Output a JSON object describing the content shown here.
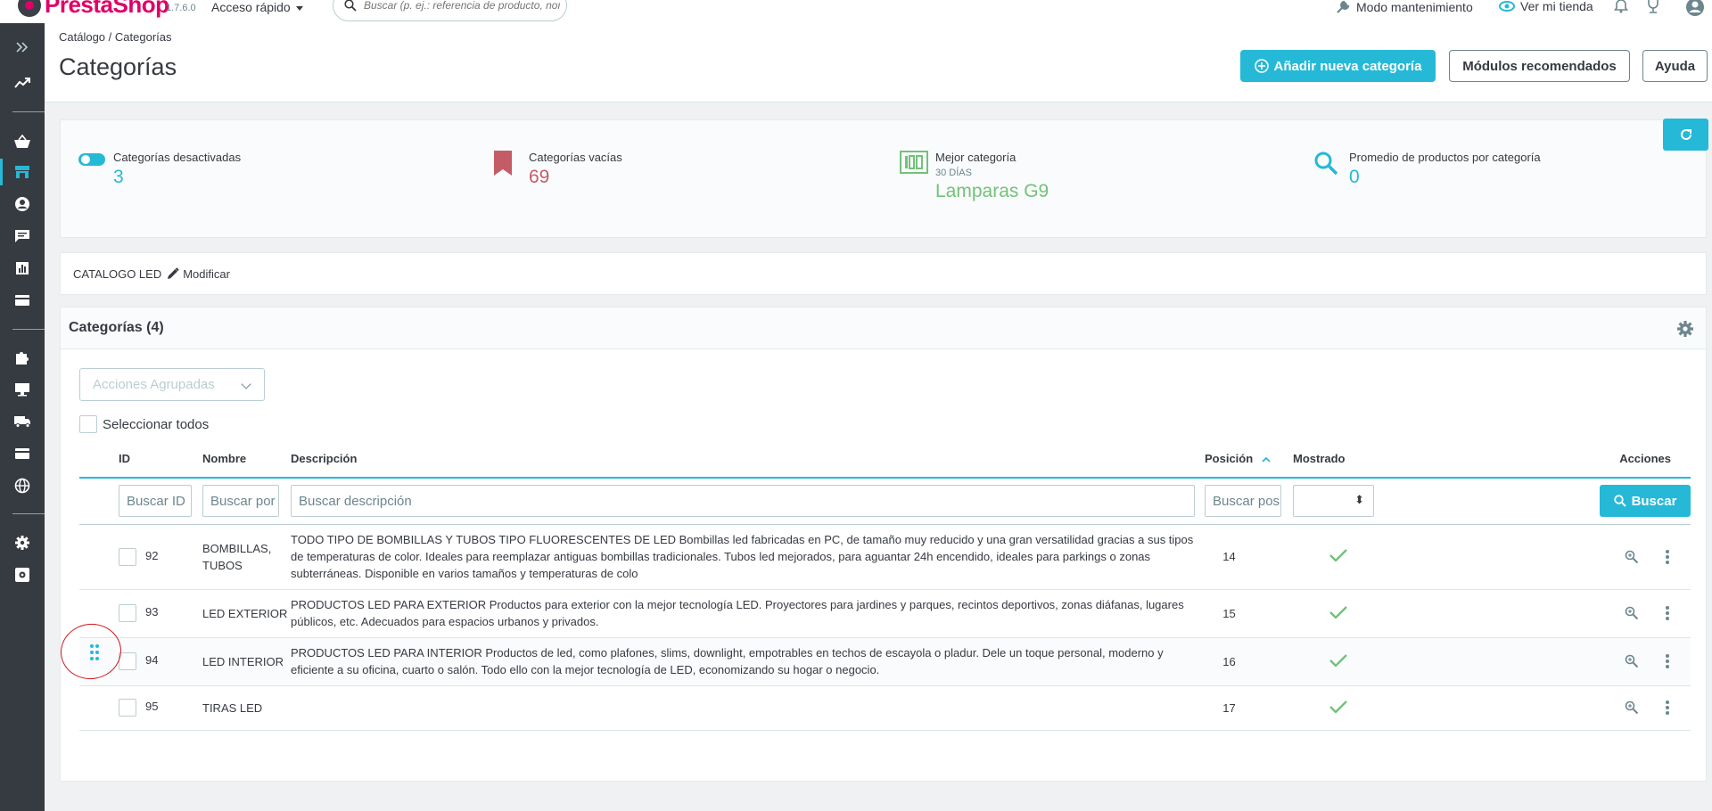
{
  "app": {
    "logo_text": "PrestaShop",
    "version": "1.7.6.0",
    "quick_access": "Acceso rápido",
    "search_placeholder": "Buscar (p. ej.: referencia de producto, nombre de cliente...)",
    "maintenance": "Modo mantenimiento",
    "view_store": "Ver mi tienda"
  },
  "sidebar": {
    "items": [
      "expand-icon",
      "trend-icon",
      "basket-icon",
      "store-icon",
      "user-icon",
      "chat-icon",
      "stats-icon",
      "card-icon",
      "puzzle-icon",
      "monitor-icon",
      "truck-icon",
      "payment-icon",
      "globe-icon",
      "gear-icon",
      "config-icon"
    ],
    "active_item": "store-icon"
  },
  "header": {
    "breadcrumb": [
      "Catálogo",
      "Categorías"
    ],
    "title": "Categorías",
    "add_button": "Añadir nueva categoría",
    "modules_button": "Módulos recomendados",
    "help_button": "Ayuda"
  },
  "kpis": [
    {
      "label": "Categorías desactivadas",
      "value": "3",
      "color": "#25b9d7"
    },
    {
      "label": "Categorías vacías",
      "value": "69",
      "color": "#c45c67"
    },
    {
      "label": "Mejor categoría",
      "sub": "30 DÍAS",
      "value": "Lamparas G9",
      "color": "#72c279"
    },
    {
      "label": "Promedio de productos por categoría",
      "value": "0",
      "color": "#25b9d7"
    }
  ],
  "catalog_bar": {
    "name": "CATALOGO LED",
    "edit": "Modificar"
  },
  "panel": {
    "title": "Categorías (4)",
    "bulk_actions": "Acciones Agrupadas",
    "select_all": "Seleccionar todos",
    "columns": {
      "id": "ID",
      "name": "Nombre",
      "description": "Descripción",
      "position": "Posición",
      "shown": "Mostrado",
      "actions": "Acciones"
    },
    "filters": {
      "id": "Buscar ID",
      "name": "Buscar por nombre",
      "description": "Buscar descripción",
      "position": "Buscar posición",
      "search_button": "Buscar"
    },
    "rows": [
      {
        "id": "92",
        "name": "BOMBILLAS, TUBOS",
        "description": "TODO TIPO DE BOMBILLAS Y TUBOS TIPO FLUORESCENTES DE LED Bombillas led fabricadas en PC, de tamaño muy reducido y una gran versatilidad gracias a sus tipos de temperaturas de color. Ideales para reemplazar antiguas bombillas tradicionales. Tubos led mejorados, para aguantar 24h encendido, ideales para parkings o zonas subterráneas. Disponible en varios tamaños y temperaturas de colo",
        "position": "14"
      },
      {
        "id": "93",
        "name": "LED EXTERIOR",
        "description": "PRODUCTOS LED PARA EXTERIOR Productos para exterior con la mejor tecnología LED. Proyectores para jardines y parques, recintos deportivos, zonas diáfanas, lugares públicos, etc. Adecuados para espacios urbanos y privados.",
        "position": "15"
      },
      {
        "id": "94",
        "name": "LED INTERIOR",
        "description": "PRODUCTOS LED PARA INTERIOR Productos de led, como plafones, slims, downlight, empotrables en techos de escayola o pladur. Dele un toque personal, moderno y eficiente a su oficina, cuarto o salón.  Todo ello con la mejor tecnología de LED, economizando su hogar o negocio.",
        "position": "16"
      },
      {
        "id": "95",
        "name": "TIRAS LED",
        "description": "",
        "position": "17"
      }
    ]
  },
  "colors": {
    "accent": "#25b9d7",
    "sidebar": "#363a41",
    "success": "#72c279",
    "annotation": "#d01616"
  }
}
